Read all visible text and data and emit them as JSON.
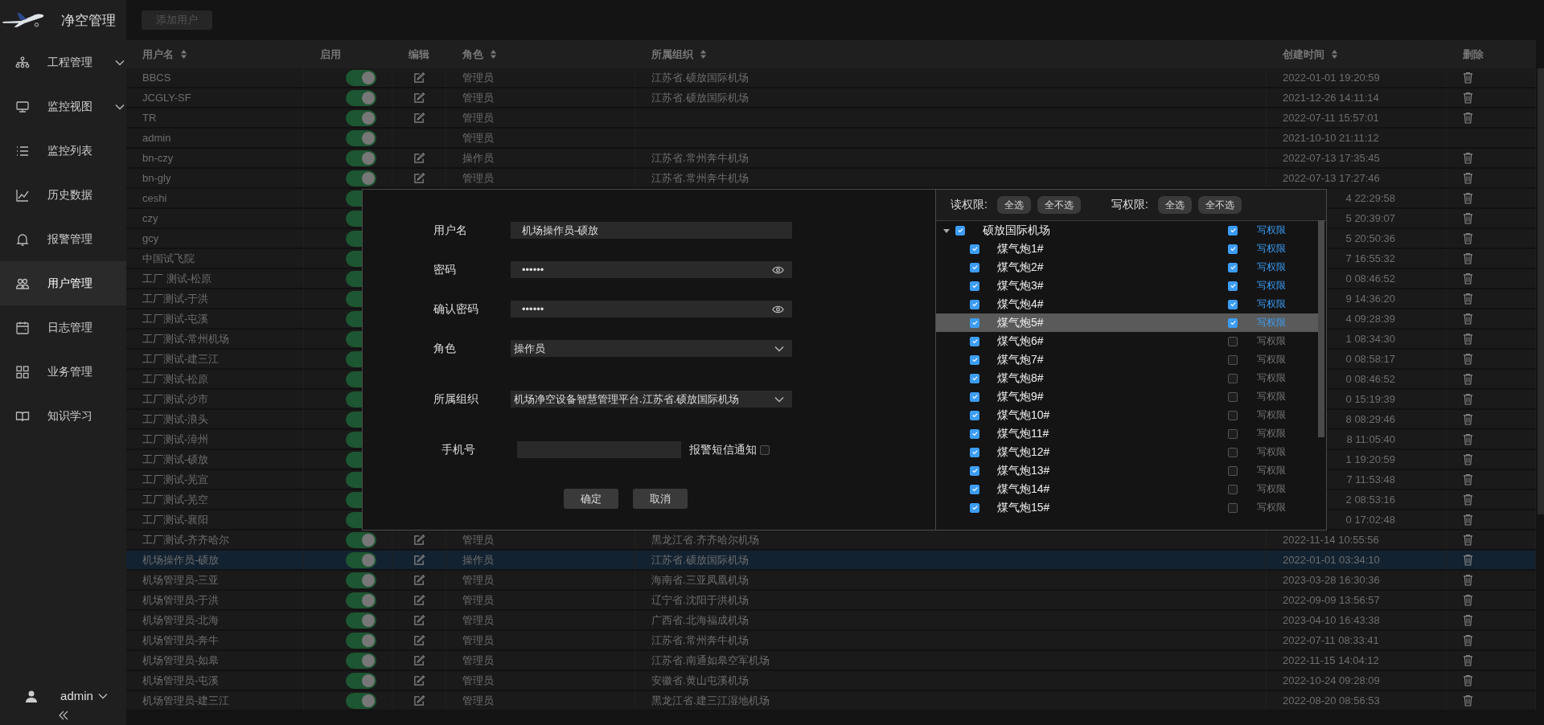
{
  "app": {
    "title": "净空管理"
  },
  "sidebar": {
    "items": [
      {
        "label": "工程管理",
        "expandable": true,
        "selected": false
      },
      {
        "label": "监控视图",
        "expandable": true,
        "selected": false
      },
      {
        "label": "监控列表",
        "expandable": false,
        "selected": false
      },
      {
        "label": "历史数据",
        "expandable": false,
        "selected": false
      },
      {
        "label": "报警管理",
        "expandable": false,
        "selected": false
      },
      {
        "label": "用户管理",
        "expandable": false,
        "selected": true
      },
      {
        "label": "日志管理",
        "expandable": false,
        "selected": false
      },
      {
        "label": "业务管理",
        "expandable": false,
        "selected": false
      },
      {
        "label": "知识学习",
        "expandable": false,
        "selected": false
      }
    ],
    "user": "admin"
  },
  "toolbar": {
    "add_button": "添加用户"
  },
  "table": {
    "columns": [
      {
        "label": "用户名",
        "sortable": true
      },
      {
        "label": "启用",
        "sortable": false
      },
      {
        "label": "编辑",
        "sortable": false
      },
      {
        "label": "角色",
        "sortable": true
      },
      {
        "label": "所属组织",
        "sortable": true
      },
      {
        "label": "创建时间",
        "sortable": true
      },
      {
        "label": "删除",
        "sortable": false
      }
    ],
    "rows": [
      {
        "name": "BBCS",
        "on": true,
        "editable": true,
        "role": "管理员",
        "org": "江苏省.硕放国际机场",
        "created": "2022-01-01 19:20:59",
        "deletable": true,
        "selected": false
      },
      {
        "name": "JCGLY-SF",
        "on": true,
        "editable": true,
        "role": "管理员",
        "org": "江苏省.硕放国际机场",
        "created": "2021-12-26 14:11:14",
        "deletable": true,
        "selected": false
      },
      {
        "name": "TR",
        "on": true,
        "editable": true,
        "role": "管理员",
        "created": "2022-07-11 15:57:01",
        "deletable": true,
        "selected": false
      },
      {
        "name": "admin",
        "on": true,
        "editable": false,
        "role": "管理员",
        "created": "2021-10-10 21:11:12",
        "deletable": false,
        "selected": false
      },
      {
        "name": "bn-czy",
        "on": true,
        "editable": true,
        "role": "操作员",
        "org": "江苏省.常州奔牛机场",
        "created": "2022-07-13 17:35:45",
        "deletable": true,
        "selected": false
      },
      {
        "name": "bn-gly",
        "on": true,
        "editable": true,
        "role": "管理员",
        "org": "江苏省.常州奔牛机场",
        "created": "2022-07-13 17:27:46",
        "deletable": true,
        "selected": false
      },
      {
        "name": "ceshi",
        "on": true,
        "created": "4 22:29:58",
        "deletable": true,
        "selected": false
      },
      {
        "name": "czy",
        "on": true,
        "created": "5 20:39:07",
        "deletable": true,
        "selected": false
      },
      {
        "name": "gcy",
        "on": true,
        "created": "5 20:50:36",
        "deletable": true,
        "selected": false
      },
      {
        "name": "中国试飞院",
        "on": true,
        "created": "7 16:55:32",
        "deletable": true,
        "selected": false
      },
      {
        "name": "工厂 测试-松原",
        "on": true,
        "created": "0 08:46:52",
        "deletable": true,
        "selected": false
      },
      {
        "name": "工厂测试-于洪",
        "on": true,
        "created": "9 14:36:20",
        "deletable": true,
        "selected": false
      },
      {
        "name": "工厂测试-屯溪",
        "on": true,
        "created": "4 09:28:39",
        "deletable": true,
        "selected": false
      },
      {
        "name": "工厂测试-常州机场",
        "on": true,
        "created": "1 08:34:30",
        "deletable": true,
        "selected": false
      },
      {
        "name": "工厂测试-建三江",
        "on": true,
        "created": "0 08:58:17",
        "deletable": true,
        "selected": false
      },
      {
        "name": "工厂测试-松原",
        "on": true,
        "created": "0 08:46:52",
        "deletable": true,
        "selected": false
      },
      {
        "name": "工厂测试-沙市",
        "on": true,
        "created": "0 15:19:39",
        "deletable": true,
        "selected": false
      },
      {
        "name": "工厂测试-浪头",
        "on": true,
        "created": "8 08:29:46",
        "deletable": true,
        "selected": false
      },
      {
        "name": "工厂测试-漳州",
        "on": true,
        "created": "8 11:05:40",
        "deletable": true,
        "selected": false
      },
      {
        "name": "工厂测试-硕放",
        "on": true,
        "created": "1 19:20:59",
        "deletable": true,
        "selected": false
      },
      {
        "name": "工厂测试-芜宣",
        "on": true,
        "created": "7 11:53:48",
        "deletable": true,
        "selected": false
      },
      {
        "name": "工厂测试-芜空",
        "on": true,
        "created": "2 08:53:16",
        "deletable": true,
        "selected": false
      },
      {
        "name": "工厂测试-襄阳",
        "on": true,
        "created": "0 17:02:48",
        "deletable": true,
        "selected": false
      },
      {
        "name": "工厂测试-齐齐哈尔",
        "on": true,
        "editable": true,
        "role": "管理员",
        "org": "黑龙江省.齐齐哈尔机场",
        "created": "2022-11-14 10:55:56",
        "deletable": true,
        "selected": false
      },
      {
        "name": "机场操作员-硕放",
        "on": true,
        "editable": true,
        "role": "操作员",
        "org": "江苏省.硕放国际机场",
        "created": "2022-01-01 03:34:10",
        "deletable": true,
        "selected": true
      },
      {
        "name": "机场管理员-三亚",
        "on": true,
        "editable": true,
        "role": "管理员",
        "org": "海南省.三亚凤凰机场",
        "created": "2023-03-28 16:30:36",
        "deletable": true,
        "selected": false
      },
      {
        "name": "机场管理员-于洪",
        "on": true,
        "editable": true,
        "role": "管理员",
        "org": "辽宁省.沈阳于洪机场",
        "created": "2022-09-09 13:56:57",
        "deletable": true,
        "selected": false
      },
      {
        "name": "机场管理员-北海",
        "on": true,
        "editable": true,
        "role": "管理员",
        "org": "广西省.北海福成机场",
        "created": "2023-04-10 16:43:38",
        "deletable": true,
        "selected": false
      },
      {
        "name": "机场管理员-奔牛",
        "on": true,
        "editable": true,
        "role": "管理员",
        "org": "江苏省.常州奔牛机场",
        "created": "2022-07-11 08:33:41",
        "deletable": true,
        "selected": false
      },
      {
        "name": "机场管理员-如皋",
        "on": true,
        "editable": true,
        "role": "管理员",
        "org": "江苏省.南通如皋空军机场",
        "created": "2022-11-15 14:04:12",
        "deletable": true,
        "selected": false
      },
      {
        "name": "机场管理员-屯溪",
        "on": true,
        "editable": true,
        "role": "管理员",
        "org": "安徽省.黄山屯溪机场",
        "created": "2022-10-24 09:28:09",
        "deletable": true,
        "selected": false
      },
      {
        "name": "机场管理员-建三江",
        "on": true,
        "editable": true,
        "role": "管理员",
        "org": "黑龙江省.建三江湿地机场",
        "created": "2022-08-20 08:56:53",
        "deletable": true,
        "selected": false
      }
    ]
  },
  "dialog": {
    "fields": [
      {
        "kind": "text",
        "label": "用户名",
        "value": "机场操作员-硕放"
      },
      {
        "kind": "password",
        "label": "密码",
        "value": "••••••"
      },
      {
        "kind": "password",
        "label": "确认密码",
        "value": "••••••"
      },
      {
        "kind": "select",
        "label": "角色",
        "value": "操作员"
      },
      {
        "kind": "select",
        "label": "所属组织",
        "value": "机场净空设备智慧管理平台.江苏省.硕放国际机场"
      },
      {
        "kind": "phone",
        "label": "手机号",
        "option": {
          "label": "报警短信通知",
          "checked": false
        }
      }
    ],
    "buttons": [
      "确定",
      "取消"
    ],
    "permissions": {
      "read_label": "读权限:",
      "read_buttons": [
        "全选",
        "全不选"
      ],
      "write_label": "写权限:",
      "write_buttons": [
        "全选",
        "全不选"
      ],
      "tree": [
        {
          "label": "硕放国际机场",
          "expanded": true,
          "read": true,
          "write": true,
          "write_label": "写权限",
          "selected": false,
          "children": [
            {
              "label": "煤气炮1#",
              "read": true,
              "write": true,
              "write_label": "写权限",
              "selected": false
            },
            {
              "label": "煤气炮2#",
              "read": true,
              "write": true,
              "write_label": "写权限",
              "selected": false
            },
            {
              "label": "煤气炮3#",
              "read": true,
              "write": true,
              "write_label": "写权限",
              "selected": false
            },
            {
              "label": "煤气炮4#",
              "read": true,
              "write": true,
              "write_label": "写权限",
              "selected": false
            },
            {
              "label": "煤气炮5#",
              "read": true,
              "write": true,
              "write_label": "写权限",
              "selected": true
            },
            {
              "label": "煤气炮6#",
              "read": true,
              "write": false,
              "write_label": "写权限",
              "selected": false
            },
            {
              "label": "煤气炮7#",
              "read": true,
              "write": false,
              "write_label": "写权限",
              "selected": false
            },
            {
              "label": "煤气炮8#",
              "read": true,
              "write": false,
              "write_label": "写权限",
              "selected": false
            },
            {
              "label": "煤气炮9#",
              "read": true,
              "write": false,
              "write_label": "写权限",
              "selected": false
            },
            {
              "label": "煤气炮10#",
              "read": true,
              "write": false,
              "write_label": "写权限",
              "selected": false
            },
            {
              "label": "煤气炮11#",
              "read": true,
              "write": false,
              "write_label": "写权限",
              "selected": false
            },
            {
              "label": "煤气炮12#",
              "read": true,
              "write": false,
              "write_label": "写权限",
              "selected": false
            },
            {
              "label": "煤气炮13#",
              "read": true,
              "write": false,
              "write_label": "写权限",
              "selected": false
            },
            {
              "label": "煤气炮14#",
              "read": true,
              "write": false,
              "write_label": "写权限",
              "selected": false
            },
            {
              "label": "煤气炮15#",
              "read": true,
              "write": false,
              "write_label": "写权限",
              "selected": false
            }
          ]
        }
      ]
    }
  }
}
